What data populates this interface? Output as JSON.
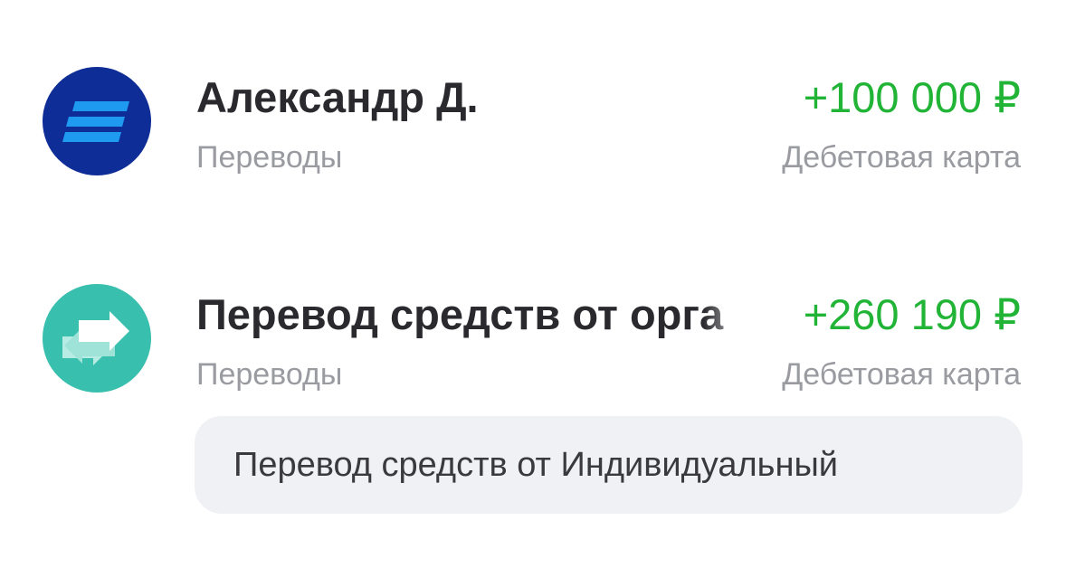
{
  "transactions": [
    {
      "title": "Александр Д.",
      "amount": "+100 000 ₽",
      "category": "Переводы",
      "account": "Дебетовая карта",
      "icon": "bank-stripes-icon",
      "icon_color": "#0f2d96",
      "amount_color": "#21b436"
    },
    {
      "title": "Перевод средств от орга",
      "amount": "+260 190 ₽",
      "category": "Переводы",
      "account": "Дебетовая карта",
      "icon": "transfer-arrows-icon",
      "icon_color": "#38bfae",
      "amount_color": "#21b436",
      "comment": "Перевод средств от Индивидуальный"
    }
  ]
}
